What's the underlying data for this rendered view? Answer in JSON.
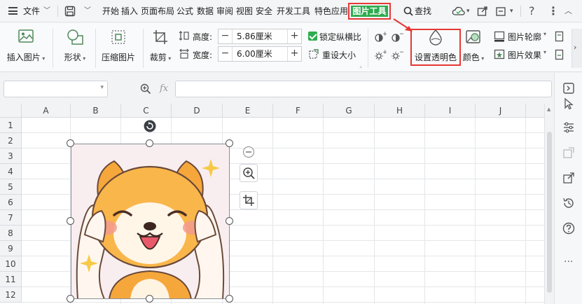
{
  "menu": {
    "file_label": "文件",
    "tabs": [
      "开始",
      "插入",
      "页面布局",
      "公式",
      "数据",
      "审阅",
      "视图",
      "安全",
      "开发工具",
      "特色应用"
    ],
    "active_tab": "图片工具",
    "search_label": "查找"
  },
  "ribbon": {
    "insert_picture": "插入图片",
    "shape": "形状",
    "compress": "压缩图片",
    "crop": "裁剪",
    "height_label": "高度:",
    "height_value": "5.86厘米",
    "width_label": "宽度:",
    "width_value": "6.00厘米",
    "lock_ratio": "锁定纵横比",
    "reset_size": "重设大小",
    "set_transparent": "设置透明色",
    "color": "颜色",
    "outline": "图片轮廓",
    "effect": "图片效果"
  },
  "formula_bar": {
    "fx": "fx"
  },
  "grid": {
    "columns": [
      "A",
      "B",
      "C",
      "D",
      "E",
      "F",
      "G",
      "H",
      "I",
      "J"
    ],
    "rows": [
      "1",
      "2",
      "3",
      "4",
      "5",
      "6",
      "7",
      "8",
      "9",
      "10",
      "11",
      "12"
    ]
  },
  "colors": {
    "accent_green": "#2eac4f",
    "highlight_red": "#e53935"
  }
}
